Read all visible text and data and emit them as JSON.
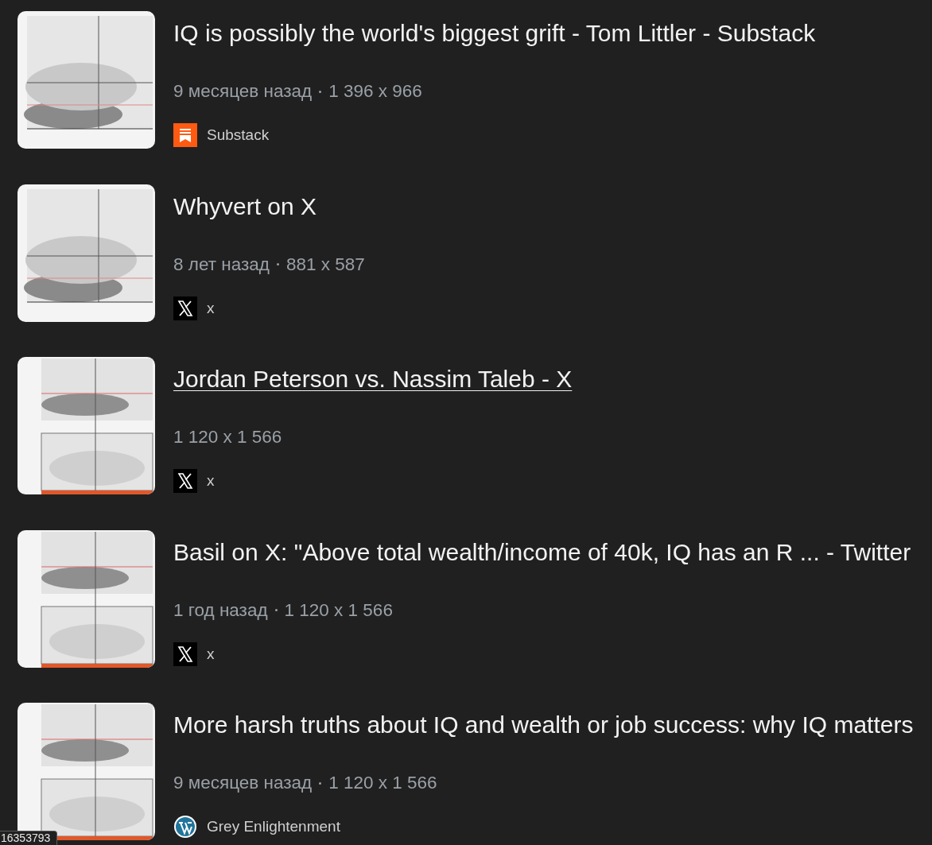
{
  "results": [
    {
      "title": "IQ is possibly the world's biggest grift - Tom Littler - Substack",
      "hovered": false,
      "age": "9 месяцев назад",
      "size": "1 396 x 966",
      "source": {
        "kind": "substack",
        "name": "Substack"
      }
    },
    {
      "title": "Whyvert on X",
      "hovered": false,
      "age": "8 лет назад",
      "size": "881 x 587",
      "source": {
        "kind": "x",
        "name": "x"
      }
    },
    {
      "title": "Jordan Peterson vs. Nassim Taleb - X",
      "hovered": true,
      "size": "1 120 x 1 566",
      "source": {
        "kind": "x",
        "name": "x"
      }
    },
    {
      "title": "Basil on X: \"Above total wealth/income of 40k, IQ has an R ... - Twitter",
      "hovered": false,
      "age": "1 год назад",
      "size": "1 120 x 1 566",
      "source": {
        "kind": "x",
        "name": "x"
      }
    },
    {
      "title": "More harsh truths about IQ and wealth or job success: why IQ matters",
      "hovered": false,
      "age": "9 месяцев назад",
      "size": "1 120 x 1 566",
      "source": {
        "kind": "wordpress",
        "name": "Grey Enlightenment"
      }
    }
  ],
  "status_bar": {
    "text": "16353793"
  }
}
